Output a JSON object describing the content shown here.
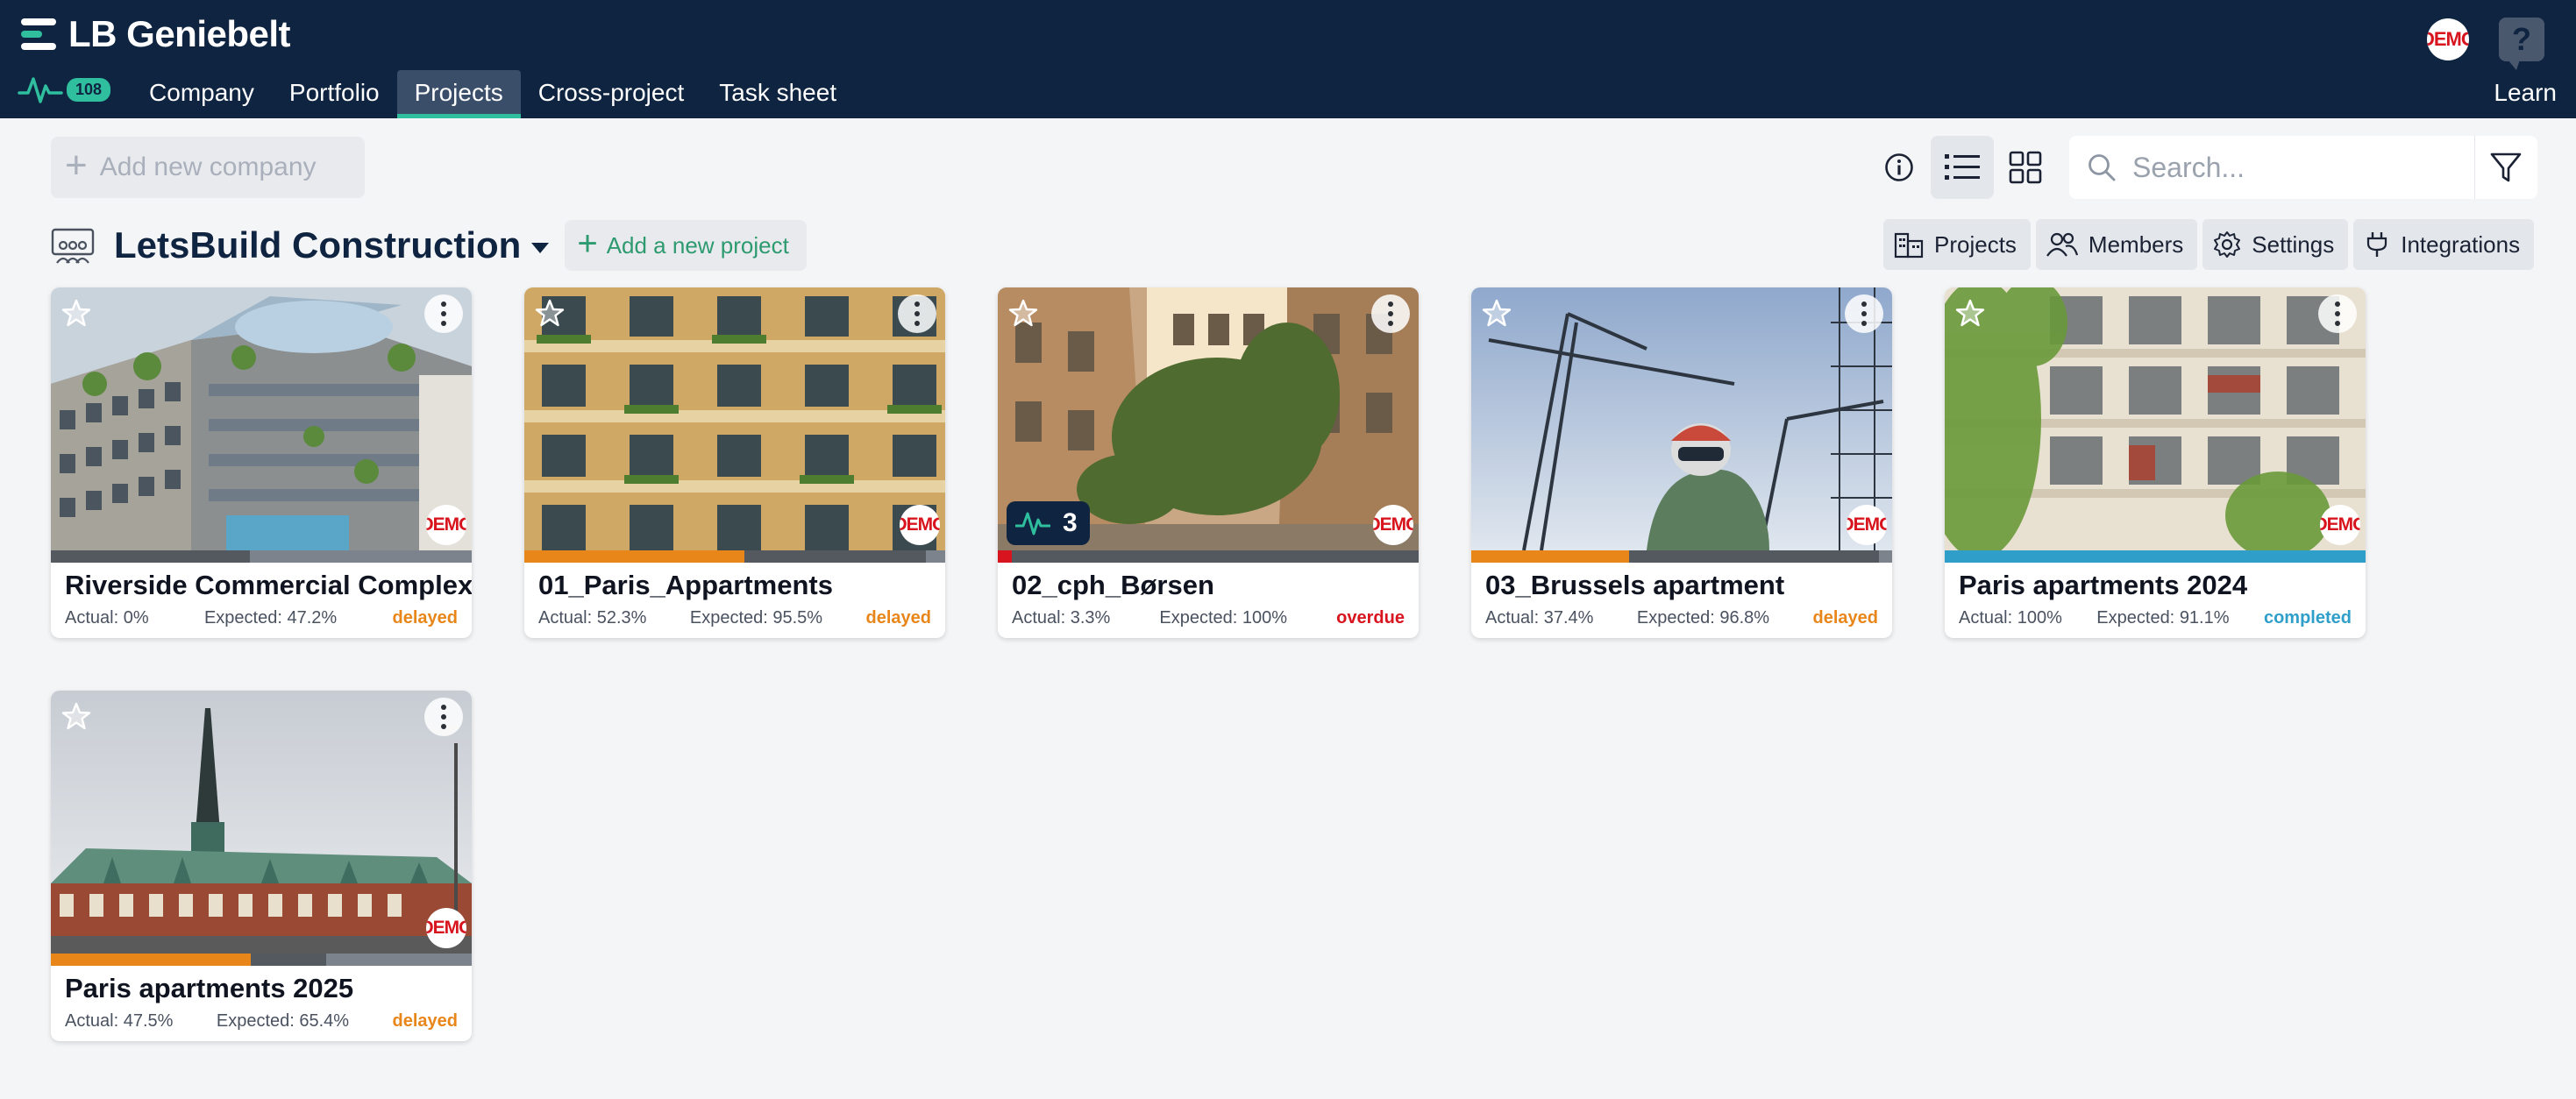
{
  "app": {
    "title": "LB Geniebelt"
  },
  "header": {
    "pulse_count": "108",
    "tabs": [
      {
        "label": "Company"
      },
      {
        "label": "Portfolio"
      },
      {
        "label": "Projects"
      },
      {
        "label": "Cross-project"
      },
      {
        "label": "Task sheet"
      }
    ],
    "learn_label": "Learn",
    "avatar_text": "DEMO",
    "help_glyph": "?"
  },
  "toolbar": {
    "add_company_label": "Add new company",
    "search_placeholder": "Search..."
  },
  "company": {
    "name": "LetsBuild Construction",
    "add_project_label": "Add a new project",
    "tabs": [
      {
        "label": "Projects"
      },
      {
        "label": "Members"
      },
      {
        "label": "Settings"
      },
      {
        "label": "Integrations"
      }
    ]
  },
  "colors": {
    "header_bg": "#0f2440",
    "accent_green": "#2fbf9f",
    "delayed": "#e8861a",
    "overdue": "#d8151e",
    "completed": "#2f9fc9"
  },
  "projects": [
    {
      "title": "Riverside Commercial Complex",
      "actual_label": "Actual:",
      "actual": "0%",
      "expected_label": "Expected:",
      "expected": "47.2%",
      "status": "delayed",
      "actual_frac": 0.0,
      "expected_frac": 0.472,
      "badge": "DEMO",
      "activity": ""
    },
    {
      "title": "01_Paris_Appartments",
      "actual_label": "Actual:",
      "actual": "52.3%",
      "expected_label": "Expected:",
      "expected": "95.5%",
      "status": "delayed",
      "actual_frac": 0.523,
      "expected_frac": 0.955,
      "badge": "DEMO",
      "activity": ""
    },
    {
      "title": "02_cph_Børsen",
      "actual_label": "Actual:",
      "actual": "3.3%",
      "expected_label": "Expected:",
      "expected": "100%",
      "status": "overdue",
      "actual_frac": 0.033,
      "expected_frac": 1.0,
      "badge": "DEMO",
      "activity": "3"
    },
    {
      "title": "03_Brussels apartment",
      "actual_label": "Actual:",
      "actual": "37.4%",
      "expected_label": "Expected:",
      "expected": "96.8%",
      "status": "delayed",
      "actual_frac": 0.374,
      "expected_frac": 0.968,
      "badge": "DEMO",
      "activity": ""
    },
    {
      "title": "Paris apartments 2024",
      "actual_label": "Actual:",
      "actual": "100%",
      "expected_label": "Expected:",
      "expected": "91.1%",
      "status": "completed",
      "actual_frac": 1.0,
      "expected_frac": 0.911,
      "badge": "DEMO",
      "activity": ""
    },
    {
      "title": "Paris apartments 2025",
      "actual_label": "Actual:",
      "actual": "47.5%",
      "expected_label": "Expected:",
      "expected": "65.4%",
      "status": "delayed",
      "actual_frac": 0.475,
      "expected_frac": 0.654,
      "badge": "DEMO",
      "activity": ""
    }
  ]
}
